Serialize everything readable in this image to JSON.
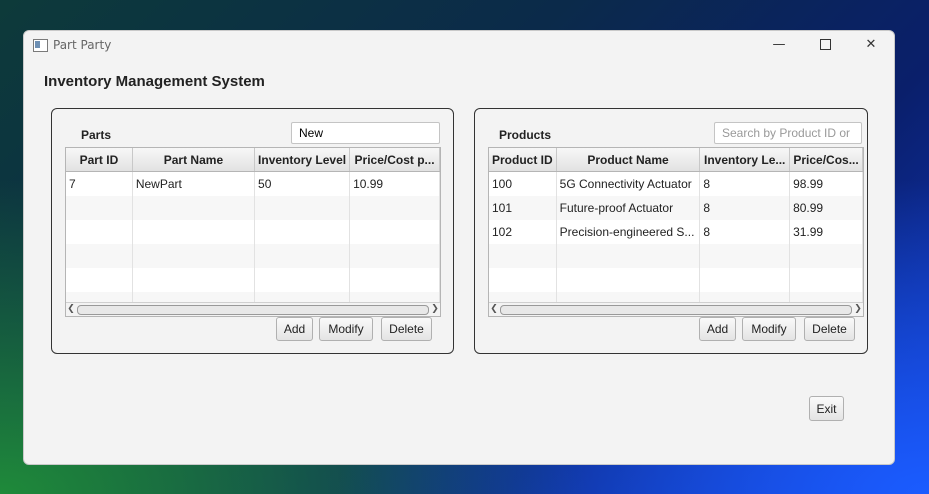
{
  "window": {
    "title": "Part Party"
  },
  "controls": {
    "minimize": "—",
    "close": "✕"
  },
  "heading": "Inventory Management System",
  "parts": {
    "label": "Parts",
    "search_value": "New",
    "columns": [
      "Part ID",
      "Part Name",
      "Inventory Level",
      "Price/Cost p..."
    ],
    "rows": [
      [
        "7",
        "NewPart",
        "50",
        "10.99"
      ]
    ],
    "buttons": {
      "add": "Add",
      "modify": "Modify",
      "delete": "Delete"
    }
  },
  "products": {
    "label": "Products",
    "search_placeholder": "Search by Product ID or N",
    "columns": [
      "Product ID",
      "Product Name",
      "Inventory Le...",
      "Price/Cos..."
    ],
    "rows": [
      [
        "100",
        "5G Connectivity Actuator",
        "8",
        "98.99"
      ],
      [
        "101",
        "Future-proof Actuator",
        "8",
        "80.99"
      ],
      [
        "102",
        "Precision-engineered S...",
        "8",
        "31.99"
      ]
    ],
    "buttons": {
      "add": "Add",
      "modify": "Modify",
      "delete": "Delete"
    }
  },
  "exit_label": "Exit"
}
